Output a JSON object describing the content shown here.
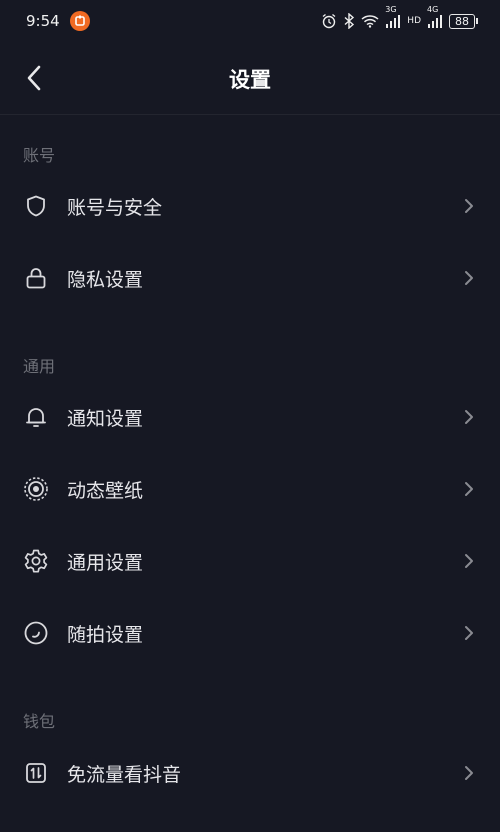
{
  "statusbar": {
    "time": "9:54",
    "net1": "3G",
    "net2": "HD",
    "net3": "4G",
    "battery": "88"
  },
  "header": {
    "title": "设置"
  },
  "sections": [
    {
      "label": "账号",
      "items": [
        {
          "label": "账号与安全",
          "icon": "shield-icon"
        },
        {
          "label": "隐私设置",
          "icon": "lock-icon"
        }
      ]
    },
    {
      "label": "通用",
      "items": [
        {
          "label": "通知设置",
          "icon": "bell-icon"
        },
        {
          "label": "动态壁纸",
          "icon": "wallpaper-icon"
        },
        {
          "label": "通用设置",
          "icon": "gear-icon"
        },
        {
          "label": "随拍设置",
          "icon": "camera-circle-icon"
        }
      ]
    },
    {
      "label": "钱包",
      "items": [
        {
          "label": "免流量看抖音",
          "icon": "data-traffic-icon"
        }
      ]
    }
  ],
  "colors": {
    "background": "#161823",
    "text": "#e6e6ea",
    "section_label": "#6e7078",
    "icon": "#d8d8dc",
    "chevron": "#8a8b92"
  }
}
